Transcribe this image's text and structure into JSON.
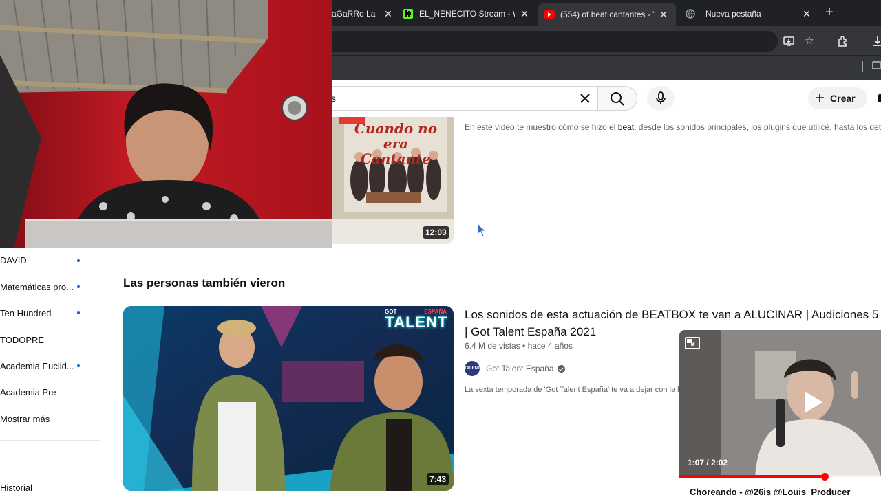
{
  "tabs": [
    {
      "title": "aGaRRo La",
      "active": false
    },
    {
      "title": "EL_NENECITO Stream - Wa",
      "active": false
    },
    {
      "title": "(554) of beat cantantes - Y",
      "active": true
    },
    {
      "title": "Nueva pestaña",
      "active": false
    }
  ],
  "search": {
    "query": "s"
  },
  "header": {
    "create_label": "Crear"
  },
  "video1": {
    "duration": "12:03",
    "thumb_text": "Cuando no era Cantante",
    "desc_prefix": "En este video te muestro cómo se hizo el ",
    "desc_bold": "beat",
    "desc_suffix": ": desde los sonidos principales, los plugins que utilicé, hasta los detalles"
  },
  "sidebar": {
    "items": [
      {
        "label": "DAVID",
        "dot": true
      },
      {
        "label": "Matemáticas pro...",
        "dot": true
      },
      {
        "label": "Ten Hundred",
        "dot": true
      },
      {
        "label": "TODOPRE",
        "dot": false
      },
      {
        "label": "Academia Euclid...",
        "dot": true
      },
      {
        "label": "Academia Pre",
        "dot": false
      },
      {
        "label": "Mostrar más",
        "dot": false
      }
    ],
    "history_label": "Historial"
  },
  "section": {
    "title": "Las personas también vieron"
  },
  "video2": {
    "title": "Los sonidos de esta actuación de BEATBOX te van a ALUCINAR | Audiciones 5 | Got Talent España 2021",
    "views": "6.4 M de vistas",
    "age": "hace 4 años",
    "channel": "Got Talent España",
    "channel_avatar_text": "TALENT",
    "description": "La sexta temporada de 'Got Talent España' te va a dejar con la boca abierta",
    "duration": "7:43",
    "badge_top": "GOT",
    "badge_main": "TALENT",
    "badge_sub": "ESPAÑA"
  },
  "mini_player": {
    "time": "1:07 / 2:02",
    "title": "Choreando - @26js  @Louis_Producer",
    "progress": 0.72
  },
  "colors": {
    "accent_red": "#ff0000",
    "link_blue": "#065fd4",
    "chrome_dark": "#202124"
  }
}
